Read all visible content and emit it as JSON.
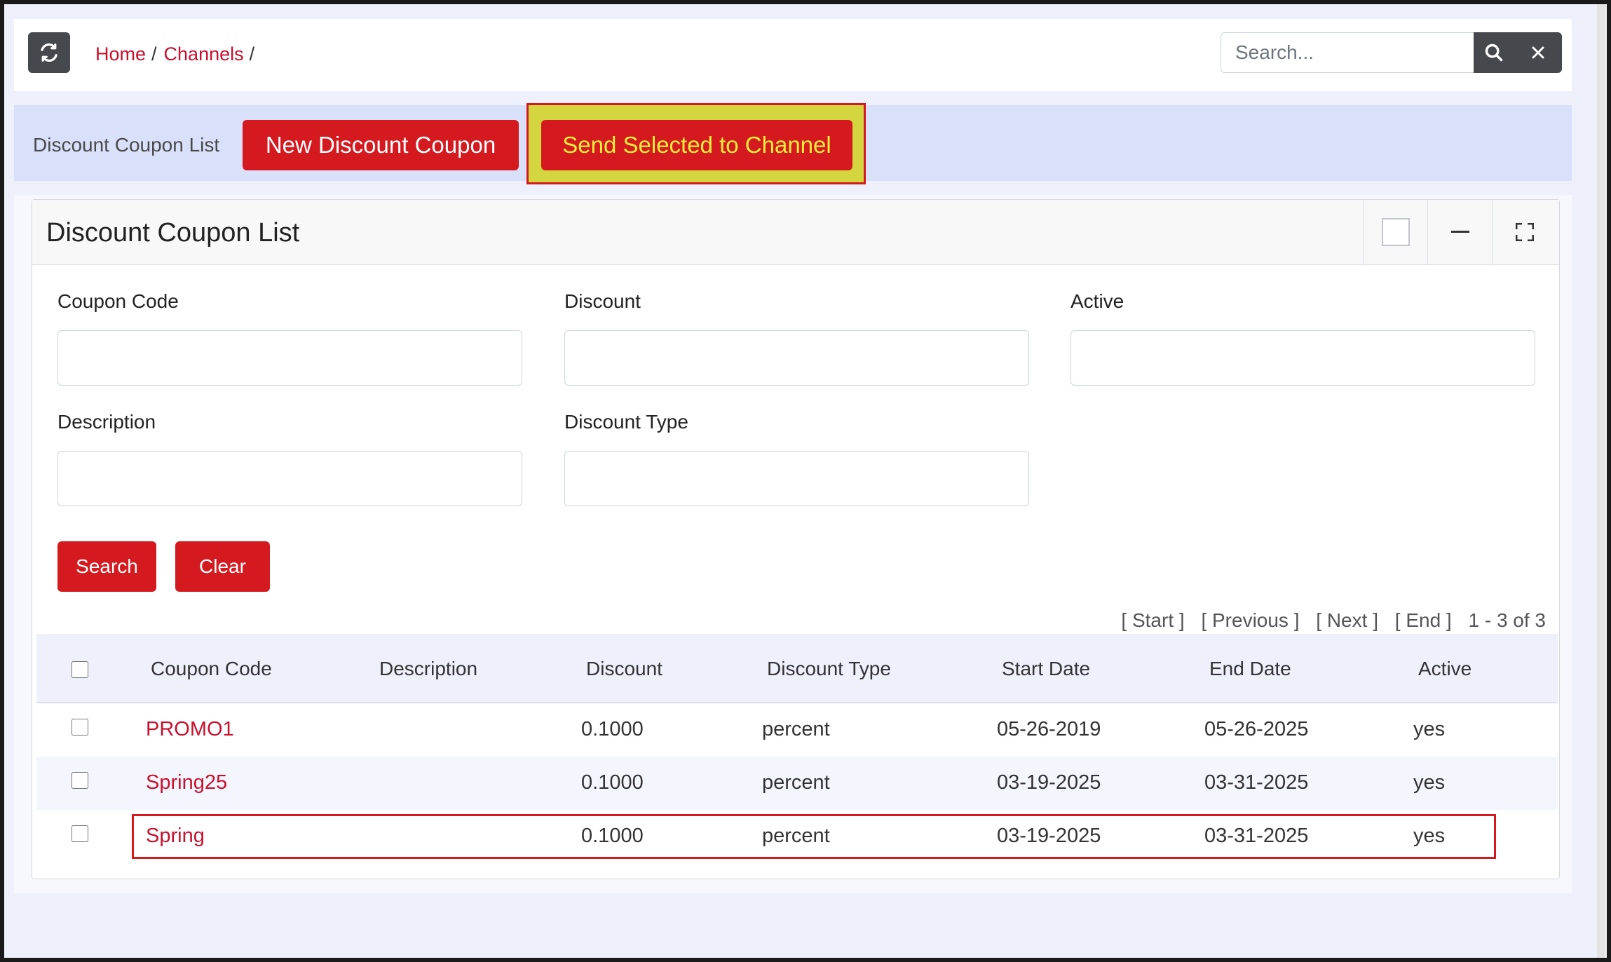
{
  "breadcrumb": {
    "home": "Home",
    "channels": "Channels",
    "sep": "/"
  },
  "search": {
    "placeholder": "Search..."
  },
  "actionbar": {
    "title": "Discount Coupon List",
    "new_button": "New Discount Coupon",
    "send_button": "Send Selected to Channel"
  },
  "card": {
    "title": "Discount Coupon List"
  },
  "filters": {
    "coupon_code_label": "Coupon Code",
    "discount_label": "Discount",
    "active_label": "Active",
    "description_label": "Description",
    "discount_type_label": "Discount Type",
    "search_button": "Search",
    "clear_button": "Clear"
  },
  "pager": {
    "start": "[ Start ]",
    "previous": "[ Previous ]",
    "next": "[ Next ]",
    "end": "[ End ]",
    "range": "1 - 3 of 3"
  },
  "table": {
    "columns": [
      "Coupon Code",
      "Description",
      "Discount",
      "Discount Type",
      "Start Date",
      "End Date",
      "Active"
    ],
    "rows": [
      {
        "code": "PROMO1",
        "description": "",
        "discount": "0.1000",
        "type": "percent",
        "start": "05-26-2019",
        "end": "05-26-2025",
        "active": "yes"
      },
      {
        "code": "Spring25",
        "description": "",
        "discount": "0.1000",
        "type": "percent",
        "start": "03-19-2025",
        "end": "03-31-2025",
        "active": "yes"
      },
      {
        "code": "Spring",
        "description": "",
        "discount": "0.1000",
        "type": "percent",
        "start": "03-19-2025",
        "end": "03-31-2025",
        "active": "yes"
      }
    ]
  },
  "colors": {
    "accent": "#d4191f",
    "link": "#c8102e",
    "dark_button": "#45494e",
    "highlight": "#d4d640"
  }
}
